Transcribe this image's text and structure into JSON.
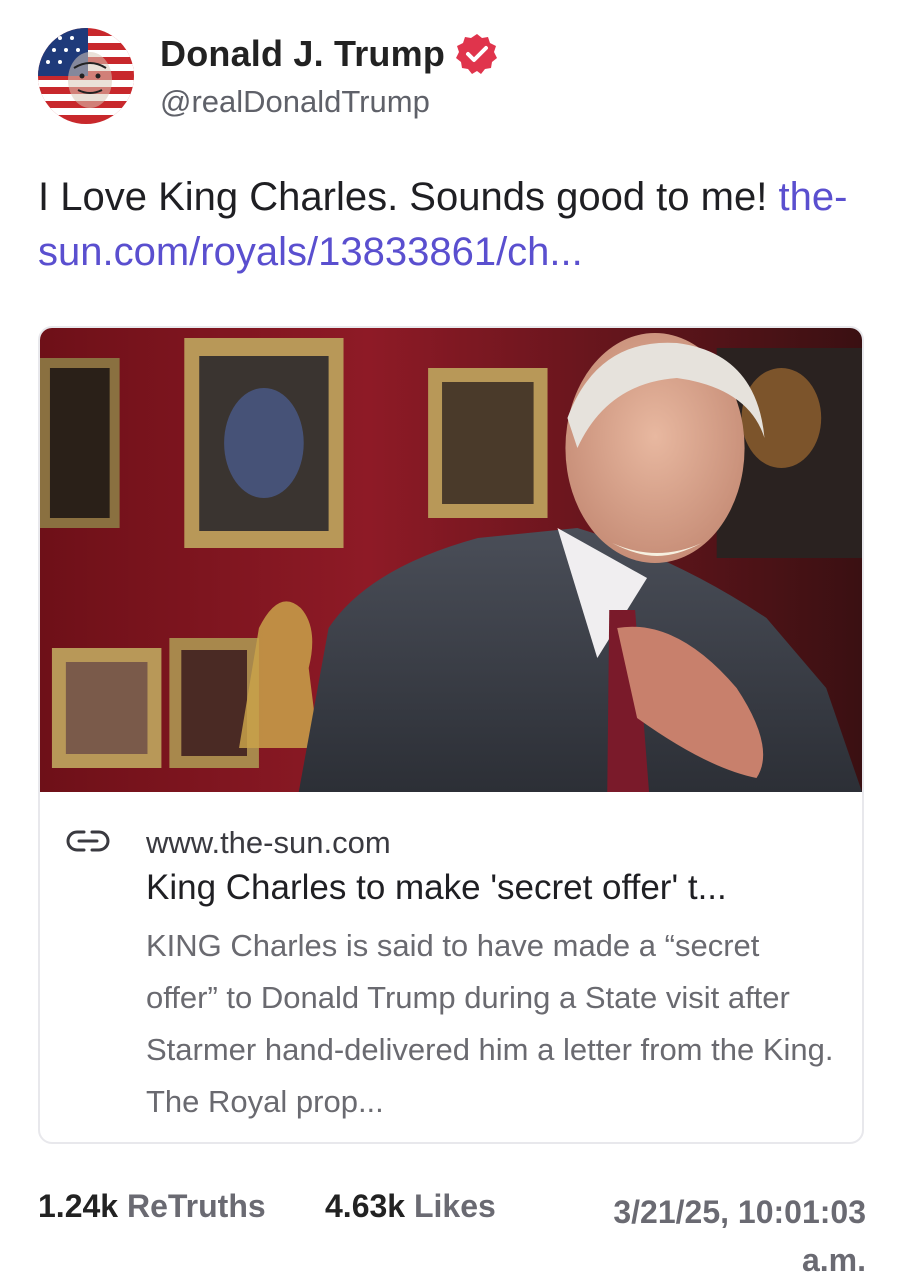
{
  "author": {
    "name": "Donald J. Trump",
    "handle": "@realDonaldTrump",
    "verified_color": "#e0344c"
  },
  "post": {
    "text": "I Love King Charles. Sounds good to me!",
    "link_text": "the-sun.com/royals/13833861/ch...",
    "link_color": "#5a4fcf"
  },
  "card": {
    "domain": "www.the-sun.com",
    "title": "King Charles to make 'secret offer' t...",
    "description": "KING Charles is said to have made a “secret offer” to Donald Trump during a State visit after Starmer hand-delivered him a letter from the King. The Royal prop..."
  },
  "stats": {
    "retruths_count": "1.24k",
    "retruths_label": "ReTruths",
    "likes_count": "4.63k",
    "likes_label": "Likes",
    "timestamp": "3/21/25, 10:01:03 a.m."
  }
}
